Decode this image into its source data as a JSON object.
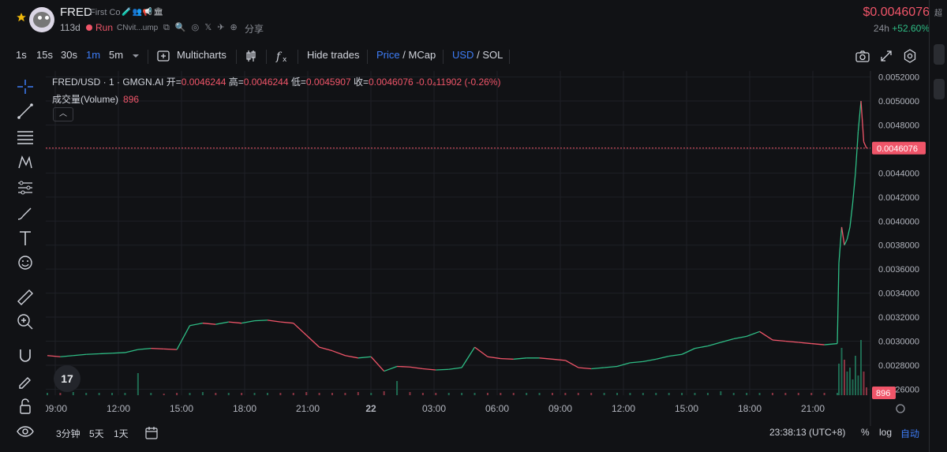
{
  "header": {
    "symbol": "FRED",
    "name": "First Co",
    "age": "113d",
    "status": "Run",
    "address": "CNvit...ump",
    "share": "分享",
    "price": "$0.0046076",
    "change_label": "24h",
    "change_value": "+52.60%",
    "edge_label": "超"
  },
  "toolbar": {
    "intervals": [
      "1s",
      "15s",
      "30s",
      "1m",
      "5m"
    ],
    "active_interval": "1m",
    "multicharts": "Multicharts",
    "hide_trades": "Hide trades",
    "price": "Price",
    "mcap": "MCap",
    "usd": "USD",
    "sol": "SOL",
    "slash": "/"
  },
  "legend": {
    "title": "FRED/USD · 1 · GMGN.AI",
    "open_label": "开=",
    "open": "0.0046244",
    "high_label": "高=",
    "high": "0.0046244",
    "low_label": "低=",
    "low": "0.0045907",
    "close_label": "收=",
    "close": "0.0046076",
    "change": "-0.0₄11902 (-0.26%)",
    "volume_label": "成交量(Volume)",
    "volume_value": "896"
  },
  "bottom": {
    "ranges": [
      "3分钟",
      "5天",
      "1天"
    ],
    "time": "23:38:13 (UTC+8)",
    "percent": "%",
    "log": "log",
    "auto": "自动"
  },
  "colors": {
    "up": "#2ebd85",
    "down": "#f05569",
    "accent": "#3d7cf6",
    "bg": "#111215"
  },
  "chart_data": {
    "type": "line",
    "title": "FRED/USD · 1 · GMGN.AI",
    "y_ticks": [
      "0.0052000",
      "0.0050000",
      "0.0048000",
      "0.0046000",
      "0.0044000",
      "0.0042000",
      "0.0040000",
      "0.0038000",
      "0.0036000",
      "0.0034000",
      "0.0032000",
      "0.0030000",
      "0.0028000",
      "0.0026000"
    ],
    "x_ticks": [
      "09:00",
      "12:00",
      "15:00",
      "18:00",
      "21:00",
      "22",
      "03:00",
      "06:00",
      "09:00",
      "12:00",
      "15:00",
      "18:00",
      "21:00"
    ],
    "ylim": [
      0.00255,
      0.00525
    ],
    "last_price": 0.0046076,
    "last_price_label": "0.0046076",
    "volume_label_value": "896",
    "series": [
      {
        "values": [
          0.00288,
          0.00287,
          0.00288,
          0.00289,
          0.002895,
          0.0029,
          0.002905,
          0.00293,
          0.00294,
          0.002935,
          0.00293,
          0.00313,
          0.00315,
          0.00314,
          0.00316,
          0.00315,
          0.00317,
          0.003175,
          0.00316,
          0.00315,
          0.00305,
          0.00295,
          0.00292,
          0.00288,
          0.00286,
          0.00287,
          0.00275,
          0.00279,
          0.002785,
          0.00277,
          0.00276,
          0.002765,
          0.00278,
          0.00295,
          0.00287,
          0.002855,
          0.00285,
          0.00286,
          0.00286,
          0.00285,
          0.00284,
          0.00278,
          0.00277,
          0.00278,
          0.00279,
          0.00282,
          0.00283,
          0.00285,
          0.002875,
          0.00289,
          0.00294,
          0.00296,
          0.00299,
          0.00302,
          0.00304,
          0.00308,
          0.00301,
          0.003,
          0.00299,
          0.00298,
          0.00297,
          0.00298,
          0.00365,
          0.00395,
          0.0038,
          0.00385,
          0.00395,
          0.00415,
          0.0044,
          0.00475,
          0.005,
          0.00466,
          0.004608
        ]
      }
    ],
    "volume": [
      3,
      3,
      4,
      3,
      3,
      3,
      3,
      28,
      3,
      2,
      3,
      3,
      4,
      3,
      3,
      3,
      3,
      3,
      3,
      3,
      4,
      3,
      3,
      3,
      4,
      3,
      5,
      18,
      4,
      3,
      3,
      3,
      3,
      3,
      3,
      3,
      3,
      3,
      3,
      3,
      3,
      3,
      3,
      3,
      3,
      3,
      3,
      3,
      3,
      3,
      3,
      3,
      5,
      3,
      3,
      3,
      3,
      3,
      3,
      3,
      3,
      3,
      40,
      60,
      45,
      30,
      35,
      20,
      50,
      25,
      70,
      30,
      10
    ]
  }
}
